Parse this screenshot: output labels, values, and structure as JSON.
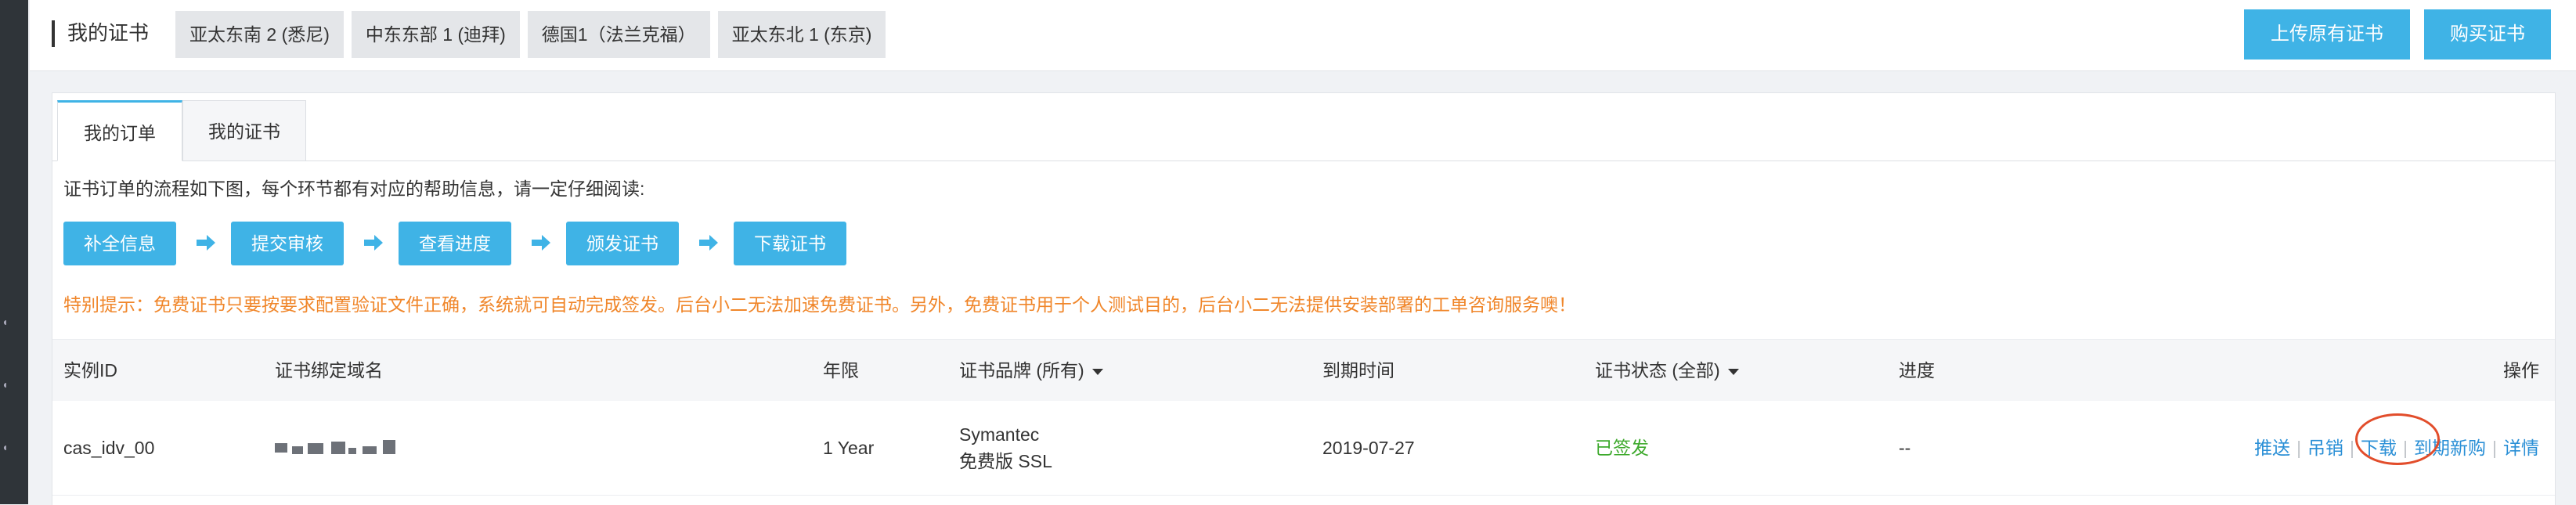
{
  "header": {
    "title": "我的证书",
    "regions": [
      "亚太东南 2 (悉尼)",
      "中东东部 1 (迪拜)",
      "德国1（法兰克福）",
      "亚太东北 1 (东京)"
    ],
    "upload_label": "上传原有证书",
    "buy_label": "购买证书"
  },
  "tabs": {
    "orders": "我的订单",
    "certs": "我的证书"
  },
  "intro": "证书订单的流程如下图，每个环节都有对应的帮助信息，请一定仔细阅读:",
  "flow_steps": [
    "补全信息",
    "提交审核",
    "查看进度",
    "颁发证书",
    "下载证书"
  ],
  "notice": "特别提示：免费证书只要按要求配置验证文件正确，系统就可自动完成签发。后台小二无法加速免费证书。另外，免费证书用于个人测试目的，后台小二无法提供安装部署的工单咨询服务噢！",
  "table": {
    "columns": {
      "id": "实例ID",
      "domain": "证书绑定域名",
      "term": "年限",
      "brand": "证书品牌 (所有)",
      "expiry": "到期时间",
      "status": "证书状态 (全部)",
      "progress": "进度",
      "ops": "操作"
    },
    "row": {
      "id": "cas_idv_00",
      "term": "1 Year",
      "brand_line1": "Symantec",
      "brand_line2": "免费版 SSL",
      "expiry": "2019-07-27",
      "status": "已签发",
      "progress": "--",
      "actions": {
        "push": "推送",
        "revoke": "吊销",
        "download": "下载",
        "renew": "到期新购",
        "detail": "详情"
      }
    }
  },
  "colors": {
    "accent": "#3fb3e6",
    "notice": "#f0862a",
    "status_ok": "#3faa2e",
    "link": "#2a8fd6",
    "highlight": "#e24d2b"
  }
}
